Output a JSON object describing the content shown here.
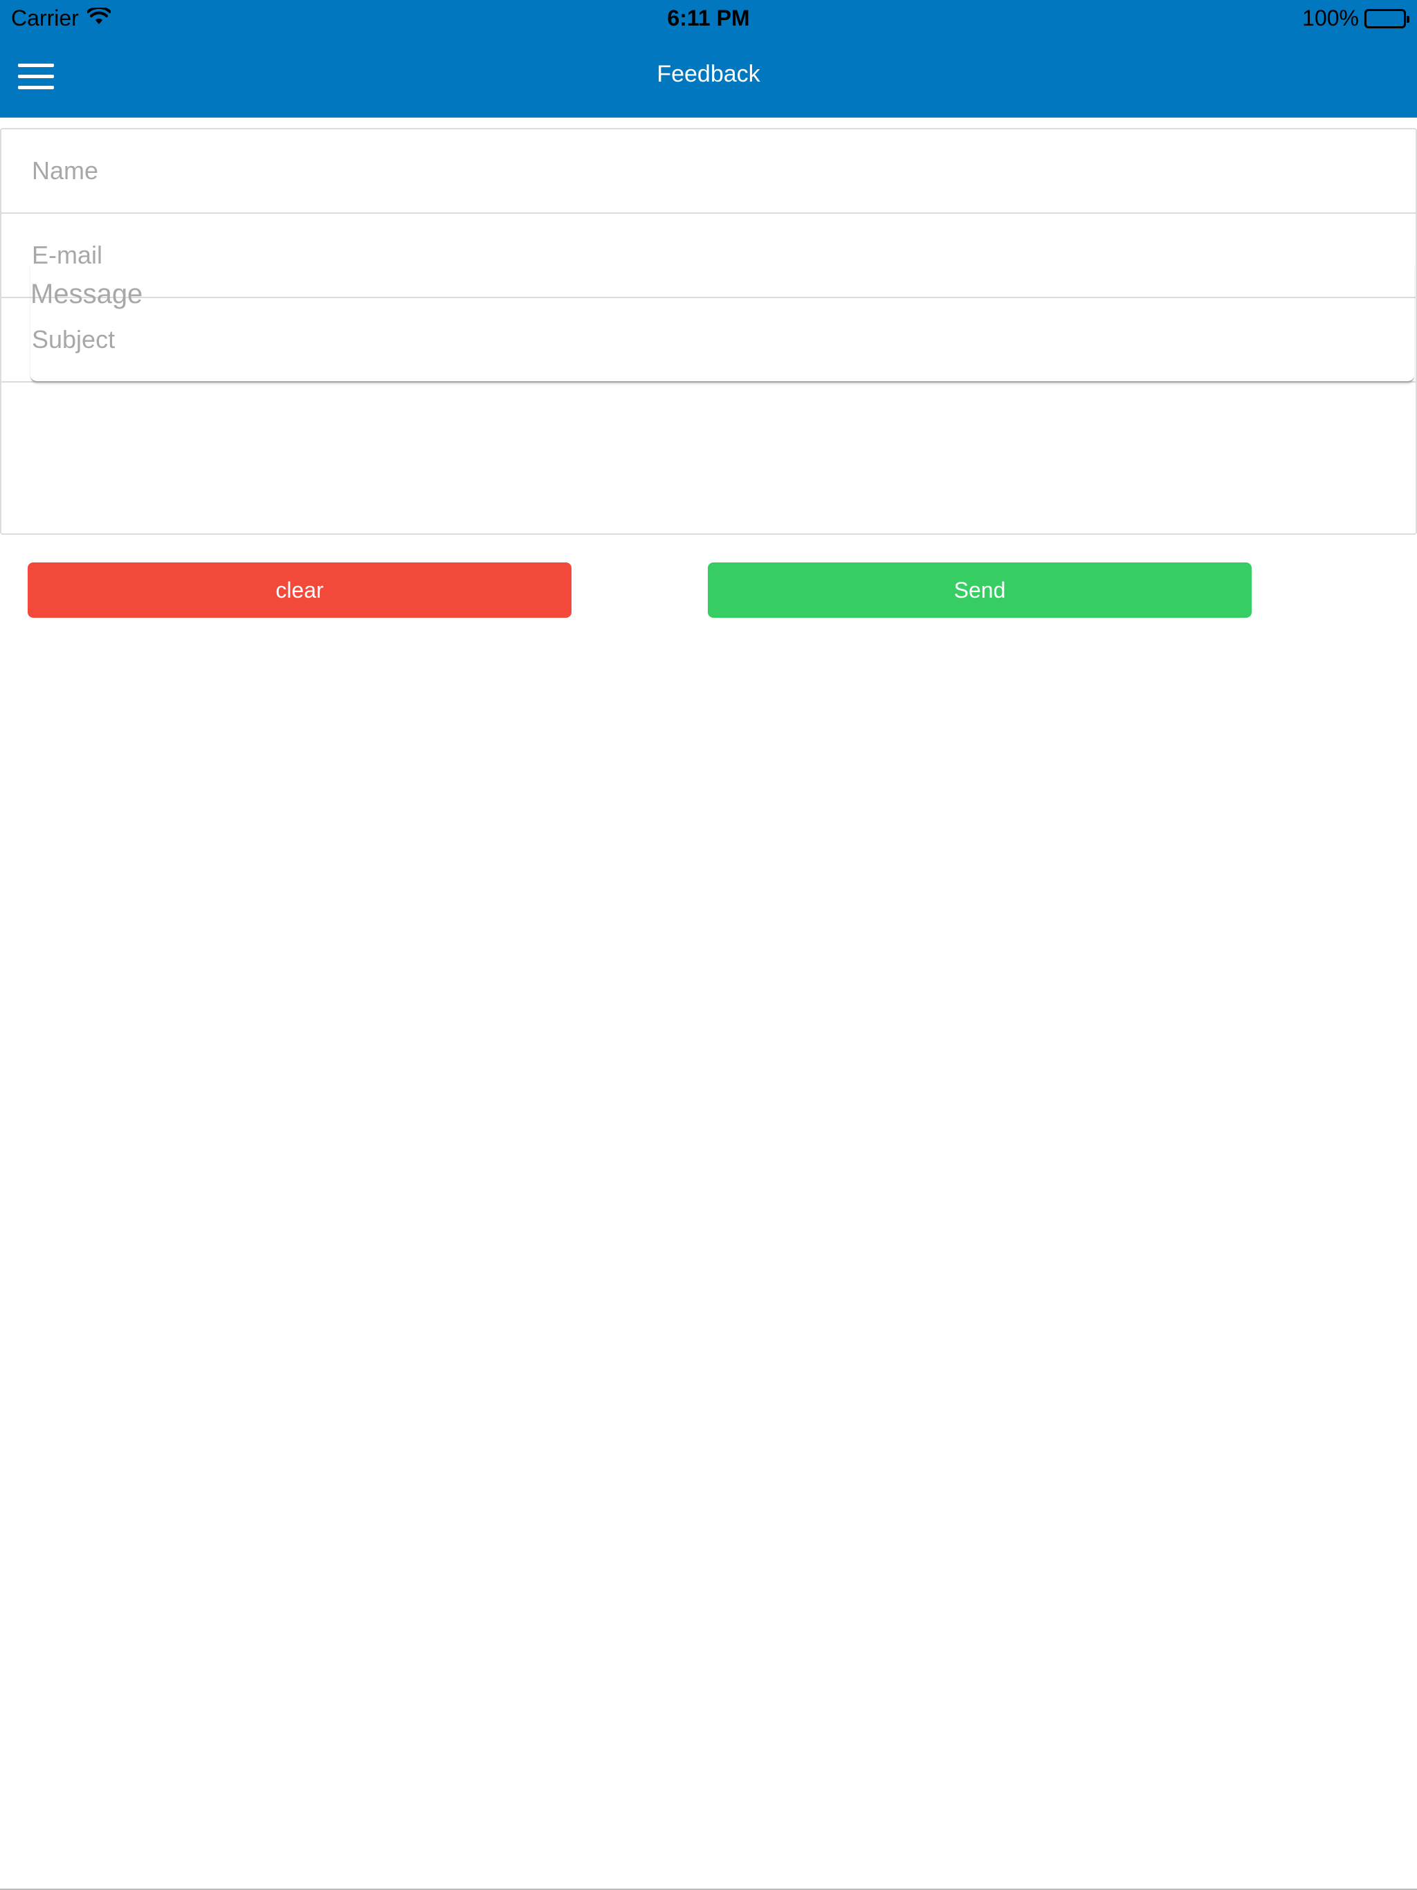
{
  "status_bar": {
    "carrier": "Carrier",
    "time": "6:11 PM",
    "battery_percent": "100%",
    "battery_level": 1.0,
    "wifi_icon": "wifi-icon",
    "battery_icon": "battery-icon"
  },
  "header": {
    "title": "Feedback",
    "menu_icon": "hamburger-menu-icon"
  },
  "form": {
    "name": {
      "placeholder": "Name",
      "value": ""
    },
    "email": {
      "placeholder": "E-mail",
      "value": ""
    },
    "subject": {
      "placeholder": "Subject",
      "value": ""
    },
    "message": {
      "placeholder": "Message",
      "value": ""
    }
  },
  "buttons": {
    "clear_label": "clear",
    "send_label": "Send"
  },
  "colors": {
    "header_bg": "#0077be",
    "clear_button": "#f2493b",
    "send_button": "#36cd63"
  }
}
